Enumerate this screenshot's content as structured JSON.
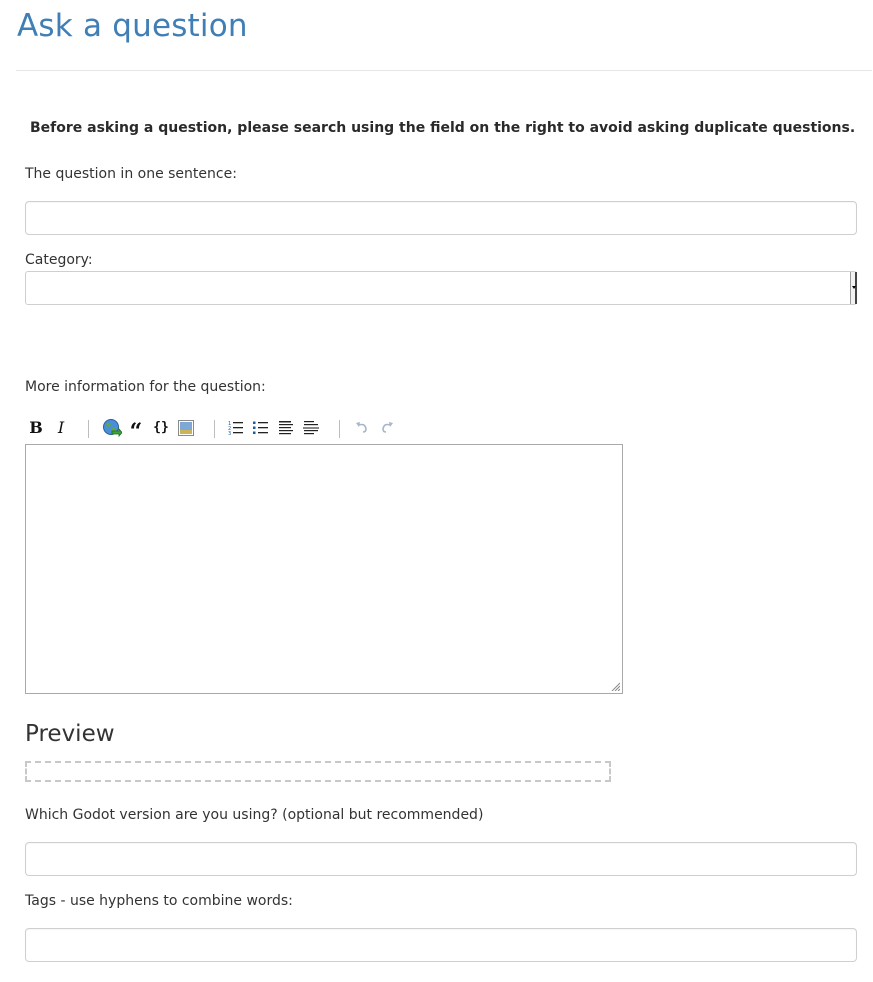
{
  "page": {
    "title": "Ask a question",
    "notice": "Before asking a question, please search using the field on the right to avoid asking duplicate questions."
  },
  "form": {
    "question_label": "The question in one sentence:",
    "question_value": "",
    "category_label": "Category:",
    "category_selected": "",
    "more_info_label": "More information for the question:",
    "editor_content": "",
    "preview_heading": "Preview",
    "version_label": "Which Godot version are you using? (optional but recommended)",
    "version_value": "",
    "tags_label": "Tags - use hyphens to combine words:",
    "tags_value": ""
  },
  "toolbar": {
    "bold_label": "B",
    "italic_label": "I",
    "quote_label": "“",
    "code_label": "{}",
    "icons": [
      "bold-icon",
      "italic-icon",
      "link-icon",
      "blockquote-icon",
      "code-icon",
      "image-icon",
      "numbered-list-icon",
      "bulleted-list-icon",
      "heading-icon",
      "horizontal-rule-icon",
      "undo-icon",
      "redo-icon"
    ]
  },
  "colors": {
    "title": "#3f7fb6",
    "border": "#cfcfcf"
  }
}
